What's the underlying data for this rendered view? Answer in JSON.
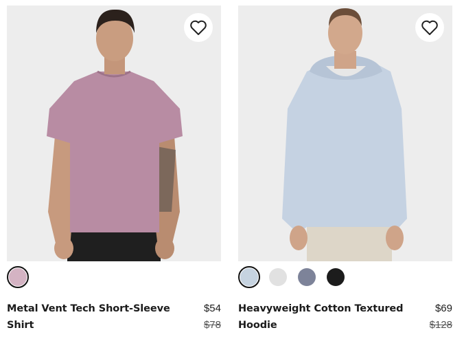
{
  "products": [
    {
      "name": "Metal Vent Tech Short-Sleeve Shirt",
      "sale_price": "$54",
      "original_price": "$78",
      "wishlist_icon": "heart-outline-icon",
      "swatch_colors": [
        "#d4b3c3"
      ],
      "selected_swatch": 0,
      "garment_color": "#b88ca3"
    },
    {
      "name": "Heavyweight Cotton Textured Hoodie",
      "sale_price": "$69",
      "original_price": "$128",
      "wishlist_icon": "heart-outline-icon",
      "swatch_colors": [
        "#c6d3e0",
        "#e1e1e1",
        "#7d8399",
        "#1c1c1c"
      ],
      "selected_swatch": 0,
      "garment_color": "#c5d2e2"
    }
  ]
}
